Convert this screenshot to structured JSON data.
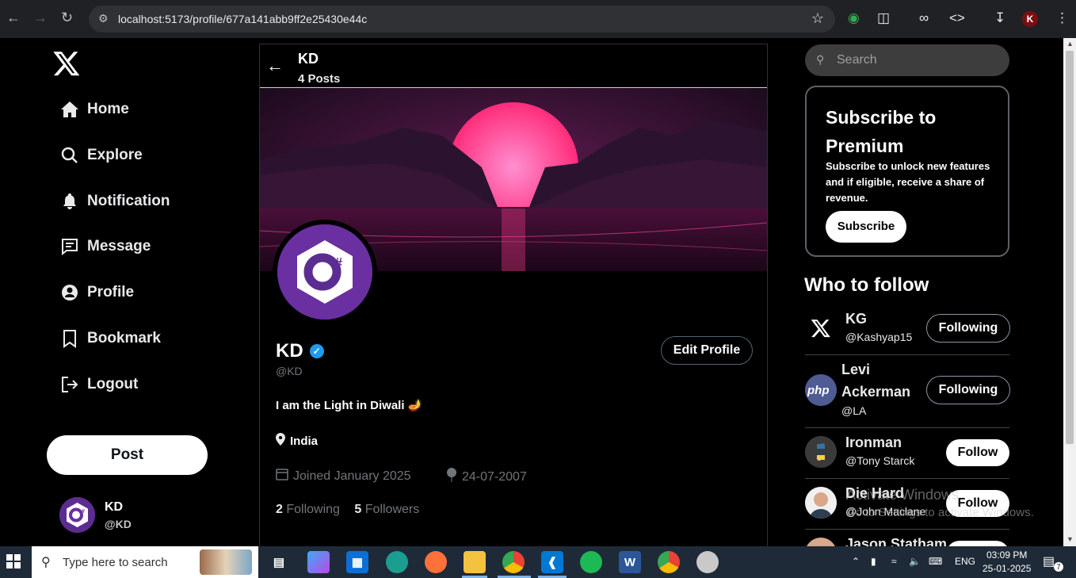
{
  "browser": {
    "url": "localhost:5173/profile/677a141abb9ff2e25430e44c",
    "profile_initial": "K"
  },
  "sidebar": {
    "items": [
      {
        "label": "Home",
        "icon": "home-icon"
      },
      {
        "label": "Explore",
        "icon": "search-icon"
      },
      {
        "label": "Notification",
        "icon": "bell-icon"
      },
      {
        "label": "Message",
        "icon": "message-icon"
      },
      {
        "label": "Profile",
        "icon": "user-icon"
      },
      {
        "label": "Bookmark",
        "icon": "bookmark-icon"
      },
      {
        "label": "Logout",
        "icon": "logout-icon"
      }
    ],
    "post_label": "Post",
    "user": {
      "name": "KD",
      "handle": "@KD"
    }
  },
  "profile": {
    "header_title": "KD",
    "header_posts": "4 Posts",
    "name": "KD",
    "handle": "@KD",
    "edit_label": "Edit Profile",
    "bio": "I am the Light in Diwali 🪔",
    "location": "India",
    "joined": "Joined January 2025",
    "birthday": "24-07-2007",
    "following_count": "2",
    "following_label": "Following",
    "followers_count": "5",
    "followers_label": "Followers"
  },
  "right": {
    "search_placeholder": "Search",
    "premium_title": "Subscribe to Premium",
    "premium_text": "Subscribe to unlock new features and if eligible, receive a share of revenue.",
    "premium_button": "Subscribe",
    "who_to_follow": "Who to follow",
    "suggestions": [
      {
        "name": "KG",
        "handle": "@Kashyap15",
        "button": "Following"
      },
      {
        "name": "Levi Ackerman",
        "handle": "@LA",
        "button": "Following"
      },
      {
        "name": "Ironman",
        "handle": "@Tony Starck",
        "button": "Follow"
      },
      {
        "name": "Die Hard",
        "handle": "@John Maclane",
        "button": "Follow"
      },
      {
        "name": "Jason Statham",
        "handle": "",
        "button": ""
      }
    ]
  },
  "watermark": {
    "line1": "Activate Windows",
    "line2": "Go to Settings to activate Windows."
  },
  "taskbar": {
    "search_placeholder": "Type here to search",
    "lang": "ENG",
    "time": "03:09 PM",
    "date": "25-01-2025",
    "notif_count": "7"
  }
}
